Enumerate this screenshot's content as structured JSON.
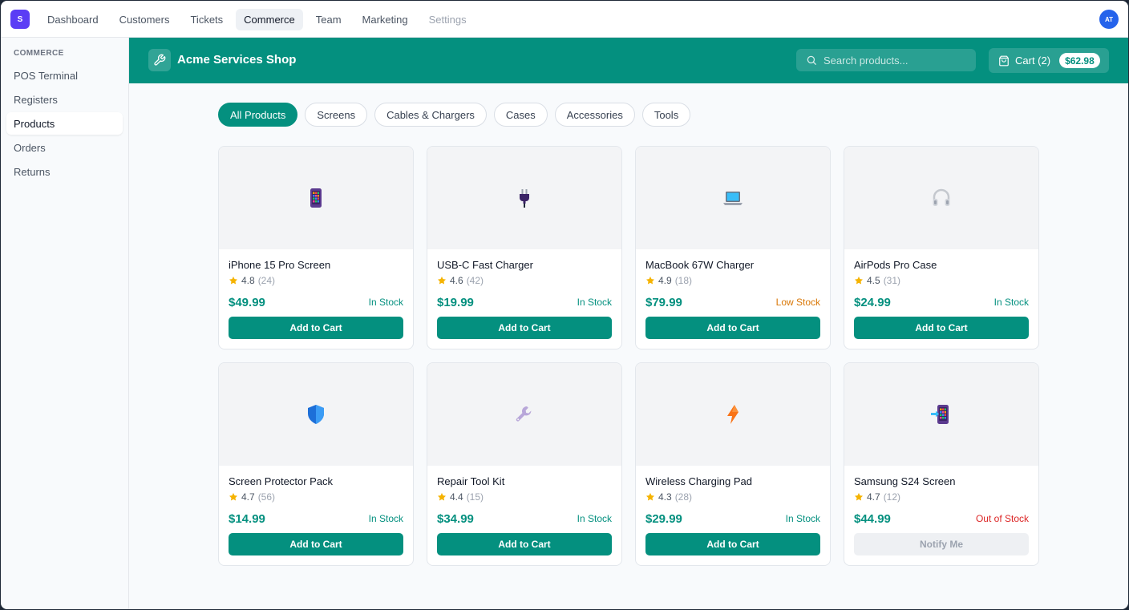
{
  "app": {
    "logo_letter": "S",
    "avatar_initials": "AT"
  },
  "nav": {
    "tabs": [
      {
        "label": "Dashboard",
        "state": "normal"
      },
      {
        "label": "Customers",
        "state": "normal"
      },
      {
        "label": "Tickets",
        "state": "normal"
      },
      {
        "label": "Commerce",
        "state": "active"
      },
      {
        "label": "Team",
        "state": "normal"
      },
      {
        "label": "Marketing",
        "state": "normal"
      },
      {
        "label": "Settings",
        "state": "muted"
      }
    ]
  },
  "sidebar": {
    "heading": "COMMERCE",
    "items": [
      {
        "label": "POS Terminal",
        "active": false
      },
      {
        "label": "Registers",
        "active": false
      },
      {
        "label": "Products",
        "active": true
      },
      {
        "label": "Orders",
        "active": false
      },
      {
        "label": "Returns",
        "active": false
      }
    ]
  },
  "shop": {
    "title": "Acme Services Shop",
    "icon": "wrench-icon",
    "search_placeholder": "Search products...",
    "cart_label": "Cart (2)",
    "cart_total": "$62.98"
  },
  "filters": [
    {
      "label": "All Products",
      "active": true
    },
    {
      "label": "Screens",
      "active": false
    },
    {
      "label": "Cables & Chargers",
      "active": false
    },
    {
      "label": "Cases",
      "active": false
    },
    {
      "label": "Accessories",
      "active": false
    },
    {
      "label": "Tools",
      "active": false
    }
  ],
  "colors": {
    "accent": "#04907f",
    "in_stock": "#04907f",
    "low_stock": "#d97706",
    "out_of_stock": "#dc2626",
    "star": "#f5b301"
  },
  "products": [
    {
      "name": "iPhone 15 Pro Screen",
      "icon": "phone-icon",
      "rating": "4.8",
      "reviews": "(24)",
      "price": "$49.99",
      "stock": "In Stock",
      "stock_status": "in",
      "button": "Add to Cart"
    },
    {
      "name": "USB-C Fast Charger",
      "icon": "plug-icon",
      "rating": "4.6",
      "reviews": "(42)",
      "price": "$19.99",
      "stock": "In Stock",
      "stock_status": "in",
      "button": "Add to Cart"
    },
    {
      "name": "MacBook 67W Charger",
      "icon": "laptop-icon",
      "rating": "4.9",
      "reviews": "(18)",
      "price": "$79.99",
      "stock": "Low Stock",
      "stock_status": "low",
      "button": "Add to Cart"
    },
    {
      "name": "AirPods Pro Case",
      "icon": "headphones-icon",
      "rating": "4.5",
      "reviews": "(31)",
      "price": "$24.99",
      "stock": "In Stock",
      "stock_status": "in",
      "button": "Add to Cart"
    },
    {
      "name": "Screen Protector Pack",
      "icon": "shield-icon",
      "rating": "4.7",
      "reviews": "(56)",
      "price": "$14.99",
      "stock": "In Stock",
      "stock_status": "in",
      "button": "Add to Cart"
    },
    {
      "name": "Repair Tool Kit",
      "icon": "wrench-icon",
      "rating": "4.4",
      "reviews": "(15)",
      "price": "$34.99",
      "stock": "In Stock",
      "stock_status": "in",
      "button": "Add to Cart"
    },
    {
      "name": "Wireless Charging Pad",
      "icon": "lightning-icon",
      "rating": "4.3",
      "reviews": "(28)",
      "price": "$29.99",
      "stock": "In Stock",
      "stock_status": "in",
      "button": "Add to Cart"
    },
    {
      "name": "Samsung S24 Screen",
      "icon": "phone-arrow-icon",
      "rating": "4.7",
      "reviews": "(12)",
      "price": "$44.99",
      "stock": "Out of Stock",
      "stock_status": "out",
      "button": "Notify Me"
    }
  ]
}
